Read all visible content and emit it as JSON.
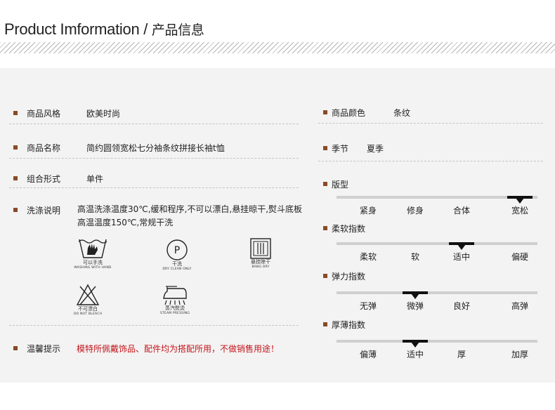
{
  "header": {
    "title_en": "Product Imformation",
    "title_sep": " / ",
    "title_cn": "产品信息"
  },
  "left": {
    "style": {
      "label": "商品风格",
      "value": "欧美时尚"
    },
    "name": {
      "label": "商品名称",
      "value": "简约圆领宽松七分袖条纹拼接长袖t恤"
    },
    "combo": {
      "label": "组合形式",
      "value": "单件"
    },
    "wash": {
      "label": "洗涤说明",
      "value": "高温洗涤温度30℃,缓和程序,不可以漂白,悬挂晾干,熨斗底板高温温度150℃,常规干洗"
    },
    "care_icons": [
      {
        "icon": "hand-wash-icon",
        "cn": "可以手洗",
        "en": "WASHING WITH HAND"
      },
      {
        "icon": "dry-clean-icon",
        "cn": "干洗",
        "en": "DRY CLEAN ONLY"
      },
      {
        "icon": "hang-dry-icon",
        "cn": "悬挂晾干",
        "en": "BANG DRY"
      },
      {
        "icon": "no-bleach-icon",
        "cn": "不可漂白",
        "en": "DO NOT BLEACH"
      },
      {
        "icon": "steam-iron-icon",
        "cn": "蒸汽熨烫",
        "en": "STEAM PRESSING"
      }
    ],
    "note": {
      "label": "温馨提示",
      "value": "模特所佩戴饰品、配件均为搭配所用，不做销售用途！"
    }
  },
  "right": {
    "color": {
      "label": "商品颜色",
      "value": "条纹"
    },
    "season": {
      "label": "季节",
      "value": "夏季"
    },
    "scales": [
      {
        "label": "版型",
        "options": [
          "紧身",
          "修身",
          "合体",
          "宽松"
        ],
        "selected_index": 3
      },
      {
        "label": "柔软指数",
        "options": [
          "柔软",
          "软",
          "适中",
          "偏硬"
        ],
        "selected_index": 2
      },
      {
        "label": "弹力指数",
        "options": [
          "无弹",
          "微弹",
          "良好",
          "高弹"
        ],
        "selected_index": 1
      },
      {
        "label": "厚薄指数",
        "options": [
          "偏薄",
          "适中",
          "厚",
          "加厚"
        ],
        "selected_index": 1
      }
    ]
  },
  "colors": {
    "bullet": "#8a4a24",
    "note_text": "#c4161c",
    "panel_bg": "#f3f3f3"
  }
}
